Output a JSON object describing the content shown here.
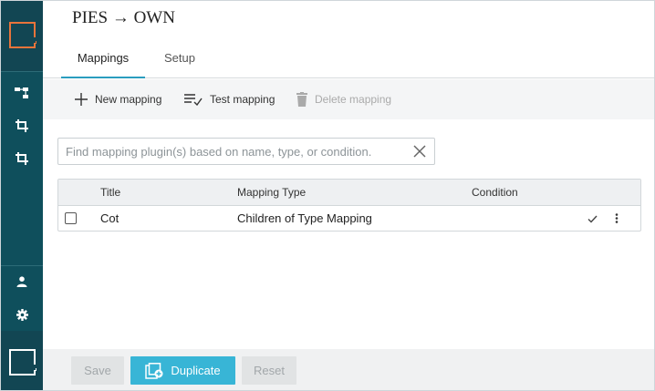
{
  "header": {
    "title": "PIES → OWN"
  },
  "tabs": [
    {
      "label": "Mappings",
      "active": true
    },
    {
      "label": "Setup",
      "active": false
    }
  ],
  "toolbar": {
    "new_mapping": "New mapping",
    "test_mapping": "Test mapping",
    "delete_mapping": "Delete mapping"
  },
  "search": {
    "placeholder": "Find mapping plugin(s) based on name, type, or condition.",
    "value": ""
  },
  "table": {
    "columns": [
      "Title",
      "Mapping Type",
      "Condition"
    ],
    "rows": [
      {
        "title": "Cot",
        "mapping_type": "Children of Type Mapping",
        "condition": ""
      }
    ]
  },
  "footer": {
    "save": "Save",
    "duplicate": "Duplicate",
    "reset": "Reset"
  },
  "colors": {
    "sidebar": "#0f4f5c",
    "accent": "#38b5d6",
    "tab_underline": "#2a9dbf",
    "logo_accent": "#e8743b"
  },
  "icons": {
    "sidebar": [
      "hierarchy-icon",
      "crop-icon",
      "crop-icon",
      "user-icon",
      "gear-icon"
    ]
  }
}
